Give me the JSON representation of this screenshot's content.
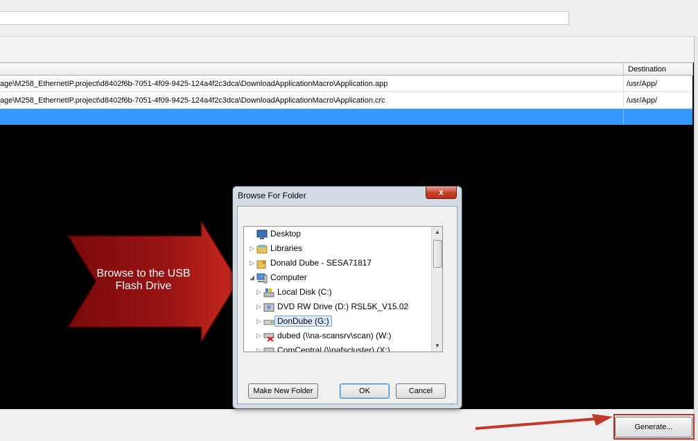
{
  "grid": {
    "destination_header": "Destination",
    "rows": [
      {
        "source": "age\\M258_EthernetIP.project\\d8402f6b-7051-4f09-9425-124a4f2c3dca\\DownloadApplicationMacro\\Application.app",
        "destination": "/usr/App/"
      },
      {
        "source": "age\\M258_EthernetIP.project\\d8402f6b-7051-4f09-9425-124a4f2c3dca\\DownloadApplicationMacro\\Application.crc",
        "destination": "/usr/App/"
      }
    ]
  },
  "annotation": {
    "text": "Browse to the USB Flash Drive",
    "color": "#8b0d0d"
  },
  "dialog": {
    "title": "Browse For Folder",
    "close_label": "x",
    "tree": [
      {
        "label": "Desktop",
        "icon": "desktop-icon",
        "expander": ""
      },
      {
        "label": "Libraries",
        "icon": "libraries-icon",
        "expander": "▷"
      },
      {
        "label": "Donald Dube - SESA71817",
        "icon": "user-folder-icon",
        "expander": "▷"
      },
      {
        "label": "Computer",
        "icon": "computer-icon",
        "expander": "◢"
      },
      {
        "label": "Local Disk (C:)",
        "icon": "local-disk-icon",
        "expander": "▷"
      },
      {
        "label": "DVD RW Drive (D:) RSL5K_V15.02",
        "icon": "dvd-drive-icon",
        "expander": "▷"
      },
      {
        "label": "DonDube (G:)",
        "icon": "usb-drive-icon",
        "expander": "▷",
        "selected": true
      },
      {
        "label": "dubed (\\\\na-scansrv\\scan) (W:)",
        "icon": "network-drive-disconnected-icon",
        "expander": "▷"
      },
      {
        "label": "ComCentral (\\\\nafscluster) (X:)",
        "icon": "network-drive-icon",
        "expander": "▷"
      }
    ],
    "buttons": {
      "make_new_folder": "Make New Folder",
      "ok": "OK",
      "cancel": "Cancel"
    }
  },
  "generate_button": "Generate...",
  "colors": {
    "selection": "#3399ff",
    "highlight_box": "#b3342a",
    "arrow": "#c0392b"
  }
}
